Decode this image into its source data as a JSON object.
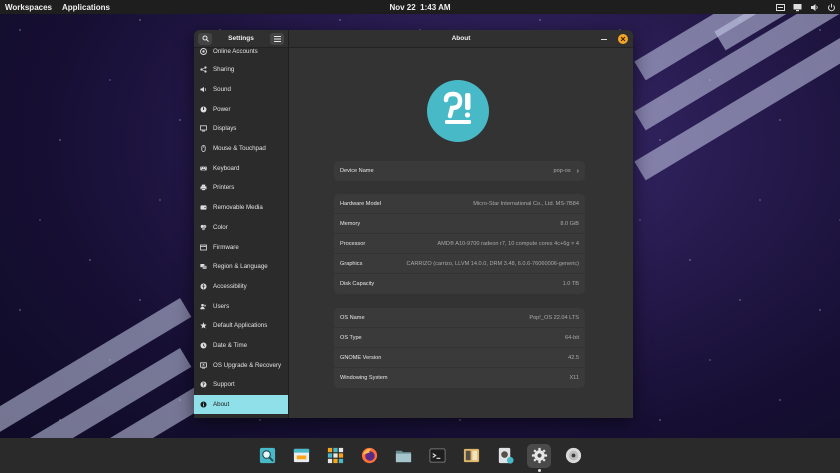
{
  "topbar": {
    "workspaces": "Workspaces",
    "applications": "Applications",
    "date": "Nov 22",
    "time": "1:43 AM"
  },
  "sidebar": {
    "title": "Settings",
    "items": [
      {
        "label": "Online Accounts",
        "icon": "at-icon"
      },
      {
        "label": "Sharing",
        "icon": "share-icon"
      },
      {
        "label": "Sound",
        "icon": "speaker-icon"
      },
      {
        "label": "Power",
        "icon": "power-icon"
      },
      {
        "label": "Displays",
        "icon": "display-icon"
      },
      {
        "label": "Mouse & Touchpad",
        "icon": "mouse-icon"
      },
      {
        "label": "Keyboard",
        "icon": "keyboard-icon"
      },
      {
        "label": "Printers",
        "icon": "printer-icon"
      },
      {
        "label": "Removable Media",
        "icon": "media-icon"
      },
      {
        "label": "Color",
        "icon": "color-icon"
      },
      {
        "label": "Firmware",
        "icon": "firmware-icon"
      },
      {
        "label": "Region & Language",
        "icon": "globe-icon"
      },
      {
        "label": "Accessibility",
        "icon": "accessibility-icon"
      },
      {
        "label": "Users",
        "icon": "users-icon"
      },
      {
        "label": "Default Applications",
        "icon": "star-icon"
      },
      {
        "label": "Date & Time",
        "icon": "clock-icon"
      },
      {
        "label": "OS Upgrade & Recovery",
        "icon": "upgrade-icon"
      },
      {
        "label": "Support",
        "icon": "support-icon"
      },
      {
        "label": "About",
        "icon": "info-icon"
      }
    ],
    "active": "About"
  },
  "main": {
    "title": "About",
    "device": {
      "label": "Device Name",
      "value": "pop-os"
    },
    "hardware": [
      {
        "label": "Hardware Model",
        "value": "Micro-Star International Co., Ltd. MS-7B84"
      },
      {
        "label": "Memory",
        "value": "8.0 GiB"
      },
      {
        "label": "Processor",
        "value": "AMD® A10-9700 radeon r7, 10 compute cores 4c+6g × 4"
      },
      {
        "label": "Graphics",
        "value": "CARRIZO (carrizo, LLVM 14.0.0, DRM 3.48, 6.0.6-76060006-generic)"
      },
      {
        "label": "Disk Capacity",
        "value": "1.0 TB"
      }
    ],
    "os": [
      {
        "label": "OS Name",
        "value": "Pop!_OS 22.04 LTS"
      },
      {
        "label": "OS Type",
        "value": "64-bit"
      },
      {
        "label": "GNOME Version",
        "value": "42.5"
      },
      {
        "label": "Windowing System",
        "value": "X11"
      }
    ]
  },
  "dock": {
    "items": [
      "file-search-icon",
      "store-icon",
      "app-grid-icon",
      "firefox-icon",
      "files-icon",
      "terminal-icon",
      "library-icon",
      "system76-icon",
      "settings-icon",
      "disc-icon"
    ],
    "active": "settings-icon"
  },
  "colors": {
    "accent": "#8fe0e8",
    "logo_bg": "#48b9c7",
    "close": "#f5a623"
  }
}
